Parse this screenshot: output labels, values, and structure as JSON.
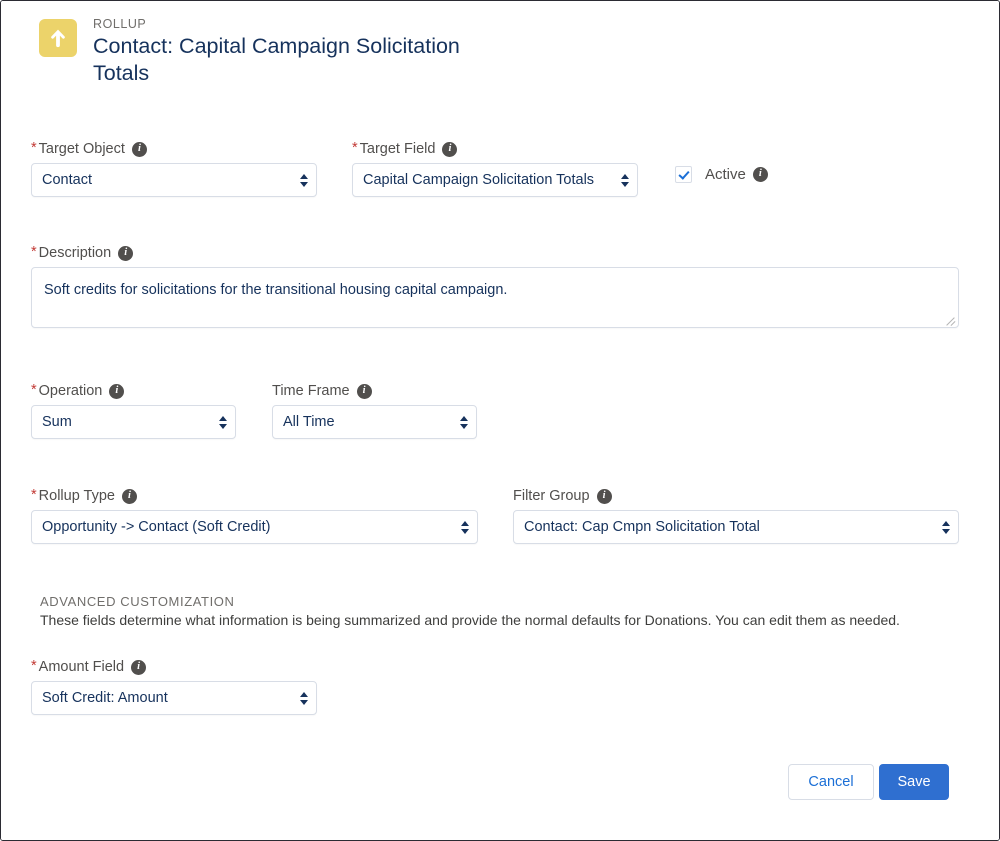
{
  "header": {
    "eyebrow": "ROLLUP",
    "title": "Contact: Capital Campaign Solicitation Totals",
    "icon": "rollup-arrow-icon",
    "icon_color": "#ecd36a"
  },
  "form": {
    "target_object": {
      "label": "Target Object",
      "required": true,
      "value": "Contact"
    },
    "target_field": {
      "label": "Target Field",
      "required": true,
      "value": "Capital Campaign Solicitation Totals"
    },
    "active": {
      "label": "Active",
      "checked": true
    },
    "description": {
      "label": "Description",
      "required": true,
      "value": "Soft credits for solicitations for the transitional housing capital campaign."
    },
    "operation": {
      "label": "Operation",
      "required": true,
      "value": "Sum"
    },
    "time_frame": {
      "label": "Time Frame",
      "required": false,
      "value": "All Time"
    },
    "rollup_type": {
      "label": "Rollup Type",
      "required": true,
      "value": "Opportunity -> Contact (Soft Credit)"
    },
    "filter_group": {
      "label": "Filter Group",
      "required": false,
      "value": "Contact: Cap Cmpn Solicitation Total"
    },
    "advanced": {
      "section_title": "ADVANCED CUSTOMIZATION",
      "section_description": "These fields determine what information is being summarized and provide the normal defaults for Donations. You can edit them as needed.",
      "amount_field": {
        "label": "Amount Field",
        "required": true,
        "value": "Soft Credit: Amount"
      }
    }
  },
  "footer": {
    "cancel_label": "Cancel",
    "save_label": "Save",
    "save_color": "#2f6fd0",
    "cancel_text_color": "#1b6fd6"
  },
  "glyphs": {
    "info": "i",
    "asterisk": "*"
  }
}
